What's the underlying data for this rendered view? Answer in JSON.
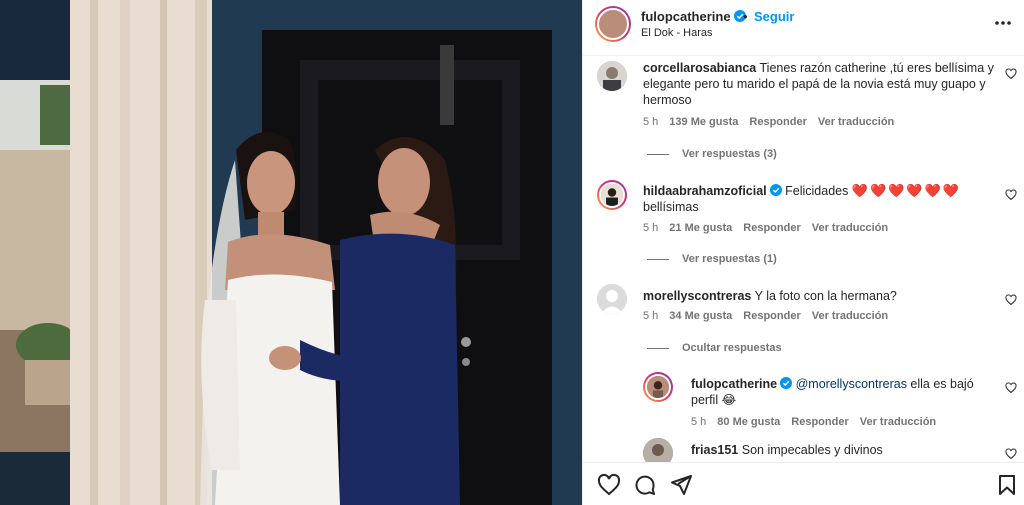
{
  "header": {
    "username": "fulopcatherine",
    "verified": true,
    "follow_label": "Seguir",
    "separator": "•",
    "location": "El Dok - Haras"
  },
  "comments": [
    {
      "username": "corcellarosabianca",
      "text": "Tienes razón catherine ,tú eres bellísima y elegante pero tu marido el papá de la novia está muy guapo y hermoso",
      "time": "5 h",
      "likes": "139 Me gusta",
      "reply_label": "Responder",
      "translate_label": "Ver traducción",
      "replies_label": "Ver respuestas (3)"
    },
    {
      "username": "hildaabrahamzoficial",
      "verified": true,
      "text": "Felicidades",
      "emoji": "❤️❤️❤️❤️❤️❤️",
      "text_after": "bellísimas",
      "time": "5 h",
      "likes": "21 Me gusta",
      "reply_label": "Responder",
      "translate_label": "Ver traducción",
      "replies_label": "Ver respuestas (1)"
    },
    {
      "username": "morellyscontreras",
      "text": "Y la foto con la hermana?",
      "time": "5 h",
      "likes": "34 Me gusta",
      "reply_label": "Responder",
      "translate_label": "Ver traducción",
      "replies_label": "Ocultar respuestas"
    }
  ],
  "reply": {
    "username": "fulopcatherine",
    "verified": true,
    "mention": "@morellyscontreras",
    "text": "ella es bajó perfil",
    "emoji": "😂",
    "time": "5 h",
    "likes": "80 Me gusta",
    "reply_label": "Responder",
    "translate_label": "Ver traducción"
  },
  "partial_comment": {
    "username": "frias151",
    "text": "Son impecables y divinos"
  },
  "icons": {
    "like": "heart-icon",
    "comment": "comment-icon",
    "share": "share-icon",
    "save": "bookmark-icon",
    "more": "more-options-icon"
  },
  "colors": {
    "link": "#0095f6",
    "verified": "#0095f6",
    "heart": "#ed4956",
    "meta": "#737373"
  }
}
